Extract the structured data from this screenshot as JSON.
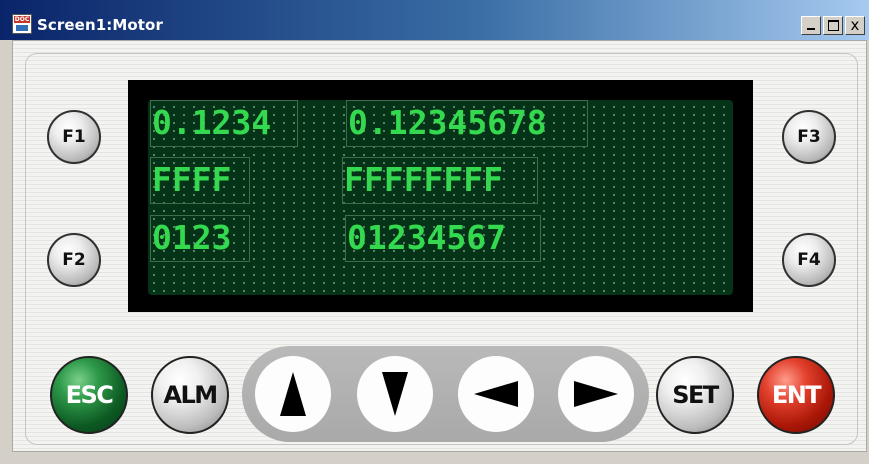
{
  "window": {
    "title": "Screen1:Motor",
    "icon_label": "DOC",
    "controls": {
      "close_glyph": "x"
    }
  },
  "display": {
    "fields": [
      {
        "value": "0.1234"
      },
      {
        "value": "0.12345678"
      },
      {
        "value": "FFFF"
      },
      {
        "value": "FFFFFFFF"
      },
      {
        "value": "0123"
      },
      {
        "value": "01234567"
      }
    ],
    "text_color": "#34d94f",
    "background_color": "#053318"
  },
  "function_keys": {
    "f1": "F1",
    "f2": "F2",
    "f3": "F3",
    "f4": "F4"
  },
  "keys": {
    "esc": "ESC",
    "alm": "ALM",
    "set": "SET",
    "ent": "ENT"
  },
  "arrow_keys": [
    "up-arrow-icon",
    "down-arrow-icon",
    "left-arrow-icon",
    "right-arrow-icon"
  ],
  "colors": {
    "esc": "#1e7a37",
    "ent": "#c4200d",
    "title_bar": "#0a246a"
  }
}
